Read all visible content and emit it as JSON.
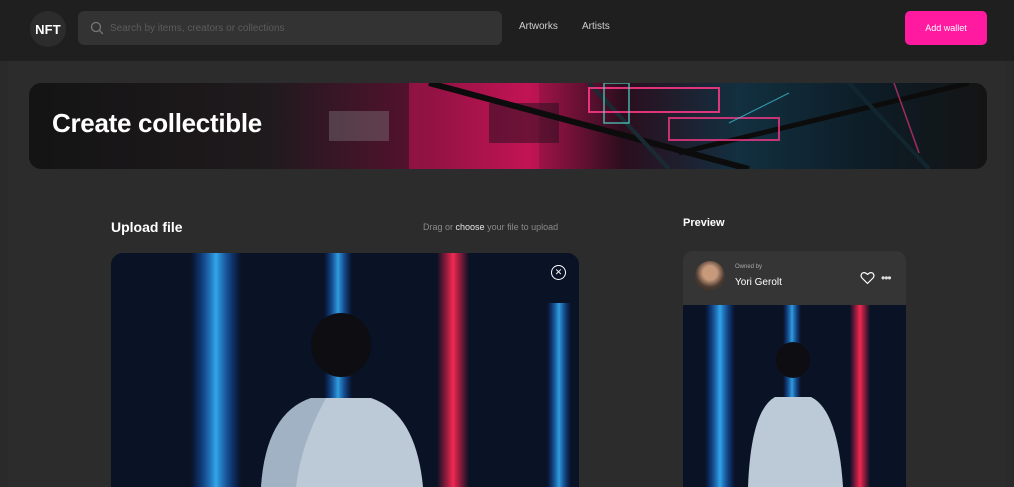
{
  "header": {
    "logo": "NFT",
    "search": {
      "placeholder": "Search by items, creators or collections"
    },
    "nav": [
      {
        "label": "Artworks"
      },
      {
        "label": "Artists"
      }
    ],
    "add_wallet_label": "Add wallet"
  },
  "banner": {
    "title": "Create collectible"
  },
  "upload": {
    "title": "Upload file",
    "hint_prefix": "Drag or",
    "hint_link": "choose",
    "hint_suffix": "your file to upload"
  },
  "preview": {
    "title": "Preview",
    "owned_by_label": "Owned by",
    "owner_name": "Yori Gerolt",
    "more_glyph": "•••"
  },
  "icons": {
    "search": "search-icon",
    "close": "close-icon",
    "heart": "heart-icon",
    "more": "more-icon"
  },
  "colors": {
    "accent": "#ff1aa0",
    "background": "#2c2c2c",
    "topbar": "#1f1f1f"
  }
}
